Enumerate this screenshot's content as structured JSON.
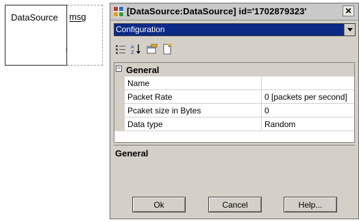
{
  "diagram": {
    "component_label": "DataSource",
    "port_label": "msg"
  },
  "dialog": {
    "title": "[DataSource:DataSource] id='1702879323'",
    "combo_value": "Configuration",
    "toolbar": {
      "icons": [
        "categorized-icon",
        "alphabetical-icon",
        "properties-icon",
        "property-pages-icon"
      ]
    },
    "grid": {
      "category": "General",
      "category_toggle": "⊟",
      "properties": [
        {
          "name": "Name",
          "value": ""
        },
        {
          "name": "Packet Rate",
          "value": "0 [packets per second]"
        },
        {
          "name": "Pcaket size in Bytes",
          "value": "0"
        },
        {
          "name": "Data type",
          "value": "Random"
        }
      ]
    },
    "description": {
      "title": "General"
    },
    "buttons": {
      "ok": "Ok",
      "cancel": "Cancel",
      "help": "Help..."
    },
    "colors": {
      "combo_selection": "#0b2a86",
      "face": "#d4d0c8"
    }
  }
}
